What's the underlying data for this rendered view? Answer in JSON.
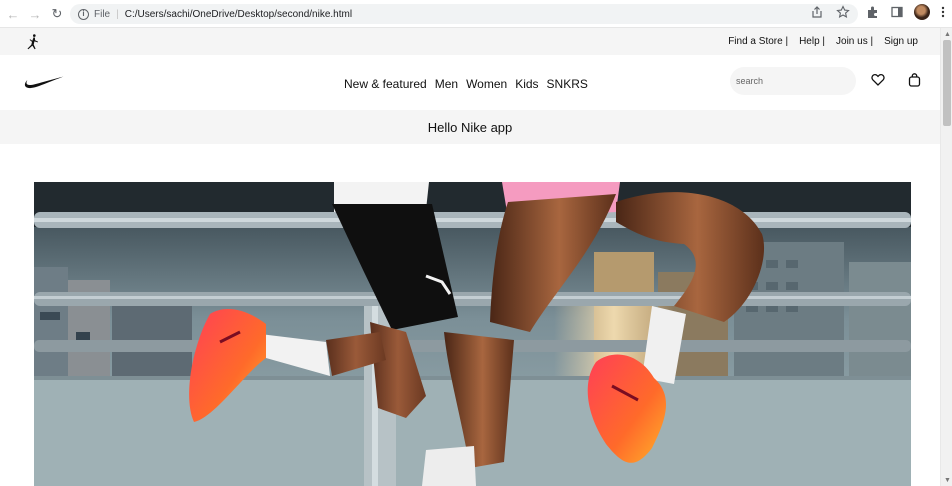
{
  "browser": {
    "back_label": "←",
    "forward_label": "→",
    "reload_label": "↻",
    "info_label": "i",
    "scheme": "File",
    "separator": "|",
    "url": "C:/Users/sachi/OneDrive/Desktop/second/nike.html",
    "icons": [
      "share-icon",
      "star-icon",
      "extensions-icon",
      "sidepanel-icon",
      "profile-avatar",
      "menu-icon"
    ]
  },
  "utility": {
    "links": [
      "Find a Store |",
      "Help |",
      "Join us |",
      "Sign up"
    ]
  },
  "nav": {
    "links": [
      "New & featured",
      "Men",
      "Women",
      "Kids",
      "SNKRS"
    ],
    "search_placeholder": "search"
  },
  "promo": {
    "text": "Hello Nike app"
  },
  "colors": {
    "utility_bg": "#f5f5f5",
    "shoe_accent": "#ff4a3d",
    "short_pink": "#f58fb7"
  }
}
